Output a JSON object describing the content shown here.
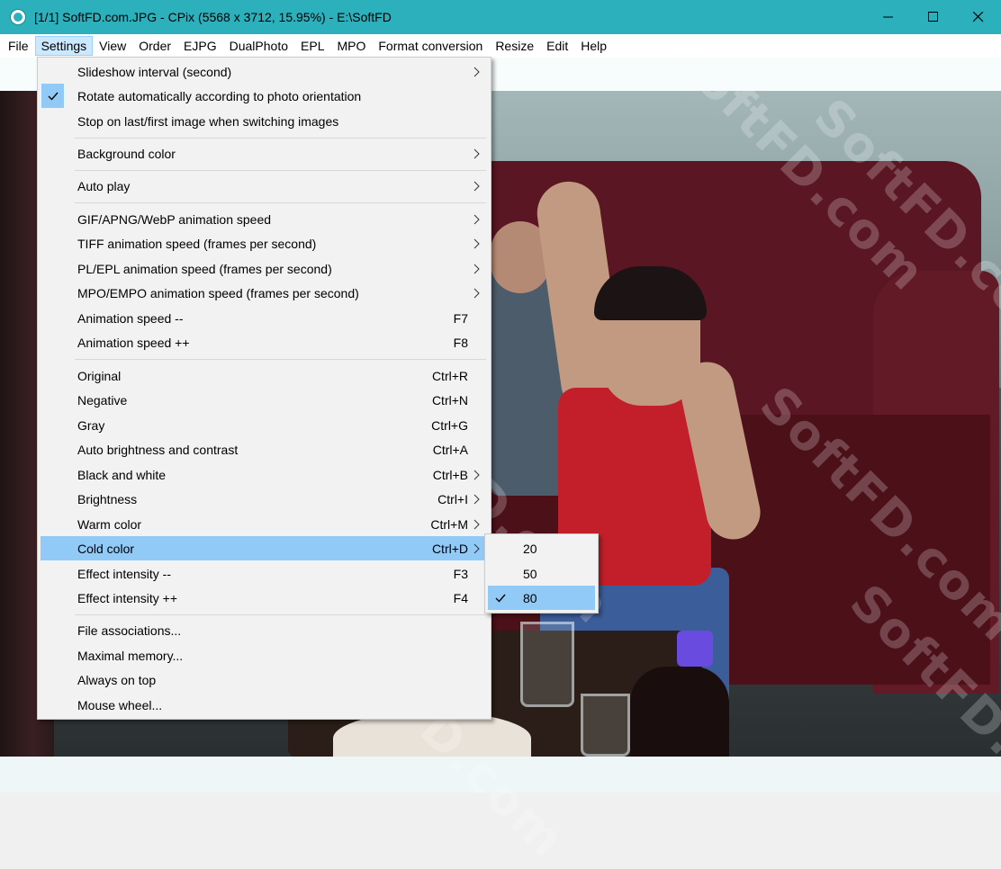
{
  "window": {
    "title": "[1/1] SoftFD.com.JPG - CPix (5568 x 3712, 15.95%) - E:\\SoftFD",
    "accent_color": "#2bb0bc"
  },
  "menubar": {
    "items": [
      "File",
      "Settings",
      "View",
      "Order",
      "EJPG",
      "DualPhoto",
      "EPL",
      "MPO",
      "Format conversion",
      "Resize",
      "Edit",
      "Help"
    ],
    "active": "Settings"
  },
  "settings_menu": {
    "items": [
      {
        "label": "Slideshow interval (second)",
        "shortcut": "",
        "submenu": true,
        "checked": false
      },
      {
        "label": "Rotate automatically according to photo orientation",
        "shortcut": "",
        "submenu": false,
        "checked": true
      },
      {
        "label": "Stop on last/first image when switching images",
        "shortcut": "",
        "submenu": false,
        "checked": false
      },
      {
        "label": "Background color",
        "shortcut": "",
        "submenu": true,
        "checked": false
      },
      {
        "label": "Auto play",
        "shortcut": "",
        "submenu": true,
        "checked": false
      },
      {
        "label": "GIF/APNG/WebP animation speed",
        "shortcut": "",
        "submenu": true,
        "checked": false
      },
      {
        "label": "TIFF animation speed (frames per second)",
        "shortcut": "",
        "submenu": true,
        "checked": false
      },
      {
        "label": "PL/EPL animation speed (frames per second)",
        "shortcut": "",
        "submenu": true,
        "checked": false
      },
      {
        "label": "MPO/EMPO animation speed (frames per second)",
        "shortcut": "",
        "submenu": true,
        "checked": false
      },
      {
        "label": "Animation speed --",
        "shortcut": "F7",
        "submenu": false,
        "checked": false
      },
      {
        "label": "Animation speed ++",
        "shortcut": "F8",
        "submenu": false,
        "checked": false
      },
      {
        "label": "Original",
        "shortcut": "Ctrl+R",
        "submenu": false,
        "checked": false
      },
      {
        "label": "Negative",
        "shortcut": "Ctrl+N",
        "submenu": false,
        "checked": false
      },
      {
        "label": "Gray",
        "shortcut": "Ctrl+G",
        "submenu": false,
        "checked": false
      },
      {
        "label": "Auto brightness and contrast",
        "shortcut": "Ctrl+A",
        "submenu": false,
        "checked": false
      },
      {
        "label": "Black and white",
        "shortcut": "Ctrl+B",
        "submenu": true,
        "checked": false
      },
      {
        "label": "Brightness",
        "shortcut": "Ctrl+I",
        "submenu": true,
        "checked": false
      },
      {
        "label": "Warm color",
        "shortcut": "Ctrl+M",
        "submenu": true,
        "checked": false
      },
      {
        "label": "Cold color",
        "shortcut": "Ctrl+D",
        "submenu": true,
        "checked": false,
        "highlighted": true
      },
      {
        "label": "Effect intensity --",
        "shortcut": "F3",
        "submenu": false,
        "checked": false
      },
      {
        "label": "Effect intensity ++",
        "shortcut": "F4",
        "submenu": false,
        "checked": false
      },
      {
        "label": "File associations...",
        "shortcut": "",
        "submenu": false,
        "checked": false
      },
      {
        "label": "Maximal memory...",
        "shortcut": "",
        "submenu": false,
        "checked": false
      },
      {
        "label": "Always on top",
        "shortcut": "",
        "submenu": false,
        "checked": false
      },
      {
        "label": "Mouse wheel...",
        "shortcut": "",
        "submenu": false,
        "checked": false
      }
    ]
  },
  "cold_color_submenu": {
    "items": [
      {
        "label": "20",
        "checked": false
      },
      {
        "label": "50",
        "checked": false
      },
      {
        "label": "80",
        "checked": true
      }
    ]
  },
  "watermark_text": "SoftFD.com",
  "colors": {
    "menu_highlight": "#91c9f7",
    "menu_bg": "#f2f2f2",
    "menubar_active": "#cce8ff"
  }
}
